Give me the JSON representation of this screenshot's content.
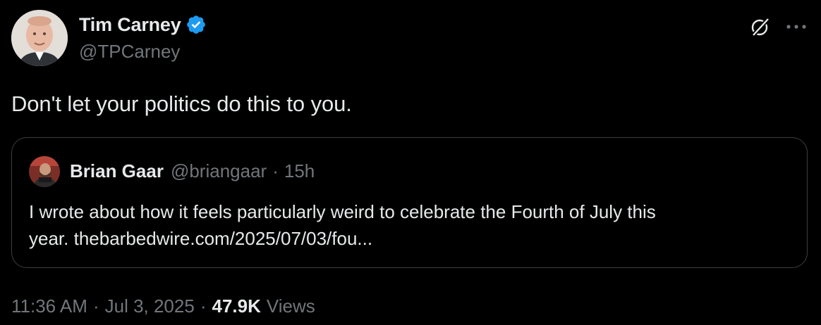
{
  "author": {
    "display_name": "Tim Carney",
    "handle": "@TPCarney",
    "verified": true
  },
  "tweet": {
    "text": "Don't let your politics do this to you."
  },
  "quoted_tweet": {
    "display_name": "Brian Gaar",
    "handle": "@briangaar",
    "separator": "·",
    "time": "15h",
    "text_line1": "I wrote about how it feels particularly weird to celebrate the Fourth of July this",
    "text_line2": "year. thebarbedwire.com/2025/07/03/fou..."
  },
  "meta": {
    "time": "11:36 AM",
    "separator": "·",
    "date": "Jul 3, 2025",
    "separator2": "·",
    "views_count": "47.9K",
    "views_label": "Views"
  },
  "icons": {
    "verified": "verified-badge-icon",
    "grok": "grok-icon",
    "more": "more-icon"
  },
  "colors": {
    "background": "#000000",
    "primary_text": "#e7e9ea",
    "secondary_text": "#71767b",
    "verified_blue": "#1d9bf0",
    "border": "#3a3d41"
  }
}
